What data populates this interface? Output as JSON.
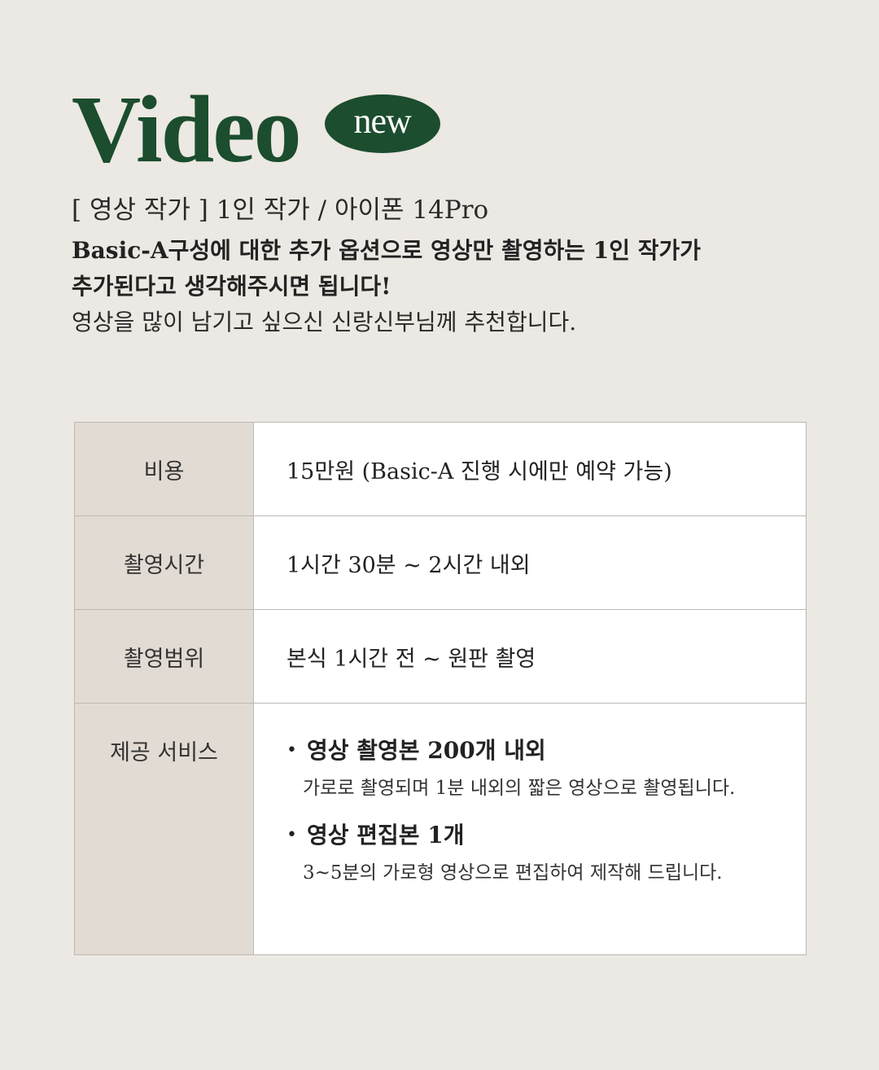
{
  "header": {
    "title": "Video",
    "badge": "new"
  },
  "intro": {
    "subtitle": "[ 영상 작가 ]   1인 작가 / 아이폰 14Pro",
    "bold_line_1": "Basic-A구성에 대한 추가 옵션으로 영상만 촬영하는 1인 작가가",
    "bold_line_2": "추가된다고 생각해주시면 됩니다!",
    "normal_line": "영상을 많이 남기고 싶으신 신랑신부님께 추천합니다."
  },
  "table": {
    "rows": [
      {
        "label": "비용",
        "value": "15만원 (Basic-A 진행 시에만 예약 가능)"
      },
      {
        "label": "촬영시간",
        "value": "1시간 30분 ~ 2시간 내외"
      },
      {
        "label": "촬영범위",
        "value": "본식 1시간 전 ~ 원판 촬영"
      }
    ],
    "services": {
      "label": "제공 서비스",
      "items": [
        {
          "title": "영상 촬영본 200개 내외",
          "desc": "가로로 촬영되며 1분 내외의 짧은 영상으로 촬영됩니다."
        },
        {
          "title": "영상 편집본 1개",
          "desc": "3~5분의 가로형 영상으로 편집하여 제작해 드립니다."
        }
      ]
    }
  },
  "colors": {
    "accent": "#1b4d2e",
    "background": "#ece8e3",
    "label_cell": "#e2dbd3",
    "border": "#bdb8b1"
  }
}
